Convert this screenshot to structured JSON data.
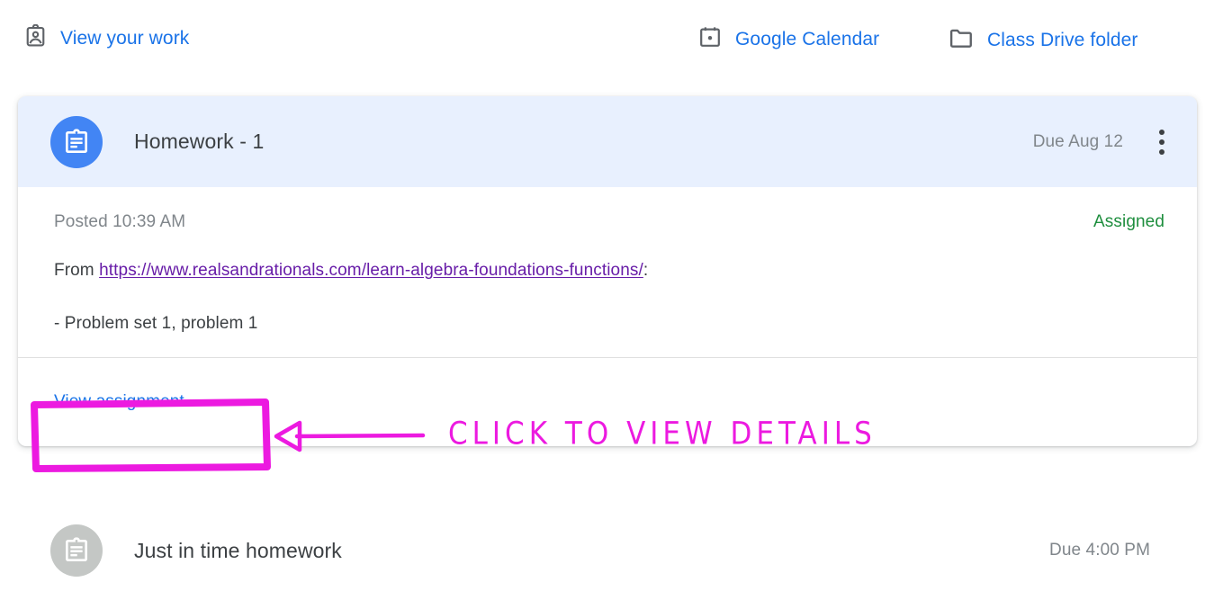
{
  "quick_links": [
    {
      "id": "view-your-work",
      "label": "View your work",
      "icon": "assignment-ind-icon"
    },
    {
      "id": "google-calendar",
      "label": "Google Calendar",
      "icon": "calendar-icon"
    },
    {
      "id": "class-drive-folder",
      "label": "Class Drive folder",
      "icon": "folder-icon"
    }
  ],
  "assignment_card": {
    "icon": "assignment-clipboard-icon",
    "title": "Homework - 1",
    "due": "Due Aug 12",
    "menu_icon": "more-vert-icon",
    "posted": "Posted 10:39 AM",
    "status": "Assigned",
    "description_prefix": "From ",
    "description_link": "https://www.realsandrationals.com/learn-algebra-foundations-functions/",
    "description_suffix": ":",
    "description_line2": "- Problem set 1, problem 1",
    "footer_link": "View assignment"
  },
  "second_assignment": {
    "icon": "assignment-clipboard-icon",
    "title": "Just in time homework",
    "due": "Due 4:00 PM"
  },
  "annotation": {
    "text": "CLICK  TO  VIEW  DETAILS",
    "color": "#ec1ae0",
    "arrow": "arrow-left",
    "highlight_box": "view-assignment-highlight"
  },
  "colors": {
    "link_blue": "#1a73e8",
    "avatar_blue": "#4285f4",
    "header_blue": "#e8f0fe",
    "status_green": "#1e8e3e",
    "visited_purple": "#681da8",
    "annotation_magenta": "#ec1ae0",
    "muted_gray": "#80868b"
  }
}
